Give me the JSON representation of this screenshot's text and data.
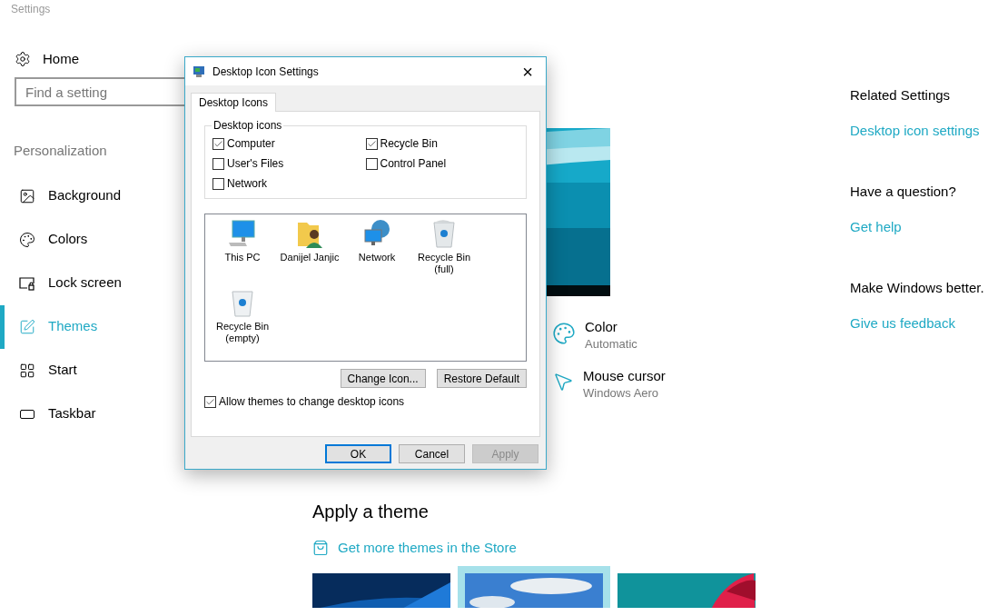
{
  "app": {
    "title": "Settings"
  },
  "sidebar": {
    "home": "Home",
    "search": {
      "placeholder": "Find a setting"
    },
    "section": "Personalization",
    "items": [
      {
        "label": "Background",
        "selected": false
      },
      {
        "label": "Colors",
        "selected": false
      },
      {
        "label": "Lock screen",
        "selected": false
      },
      {
        "label": "Themes",
        "selected": true
      },
      {
        "label": "Start",
        "selected": false
      },
      {
        "label": "Taskbar",
        "selected": false
      }
    ]
  },
  "main": {
    "settings": [
      {
        "label": "Color",
        "value": "Automatic"
      },
      {
        "label": "Mouse cursor",
        "value": "Windows Aero"
      }
    ],
    "apply_heading": "Apply a theme",
    "store_link": "Get more themes in the Store",
    "themes": [
      {
        "kind": "picture",
        "selected": false
      },
      {
        "kind": "picture",
        "selected": true
      },
      {
        "kind": "picture",
        "selected": false
      }
    ]
  },
  "related": [
    {
      "heading": "Related Settings",
      "link": "Desktop icon settings"
    },
    {
      "heading": "Have a question?",
      "link": "Get help"
    },
    {
      "heading": "Make Windows better.",
      "link": "Give us feedback"
    }
  ],
  "dialog": {
    "title": "Desktop Icon Settings",
    "close": "×",
    "tabs": [
      {
        "label": "Desktop Icons",
        "selected": true
      }
    ],
    "group": {
      "legend": "Desktop icons",
      "checkboxes": [
        {
          "label": "Computer",
          "checked": true
        },
        {
          "label": "Recycle Bin",
          "checked": true
        },
        {
          "label": "User's Files",
          "checked": false
        },
        {
          "label": "Control Panel",
          "checked": false
        },
        {
          "label": "Network",
          "checked": false
        }
      ]
    },
    "icons": [
      {
        "label": "This PC"
      },
      {
        "label": "Danijel Janjic"
      },
      {
        "label": "Network"
      },
      {
        "label": "Recycle Bin (full)"
      },
      {
        "label": "Recycle Bin (empty)"
      }
    ],
    "icon_buttons": [
      "Change Icon...",
      "Restore Default"
    ],
    "allow": {
      "label": "Allow themes to change desktop icons",
      "checked": true
    },
    "footer_buttons": [
      {
        "label": "OK",
        "default": true,
        "disabled": false
      },
      {
        "label": "Cancel",
        "default": false,
        "disabled": false
      },
      {
        "label": "Apply",
        "default": false,
        "disabled": true
      }
    ]
  }
}
